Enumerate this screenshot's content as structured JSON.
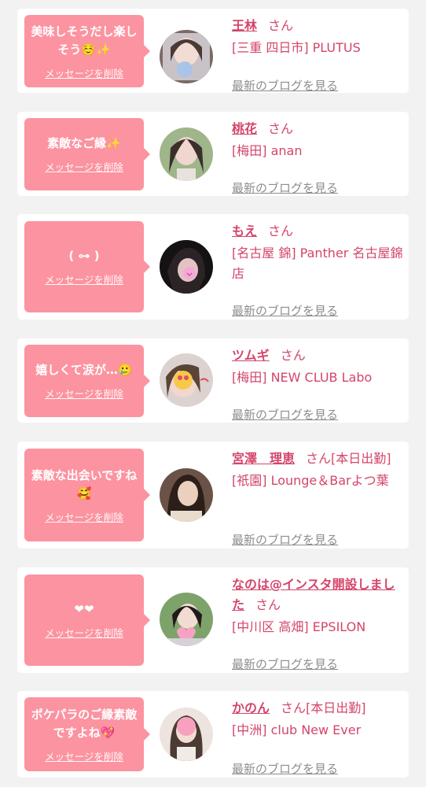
{
  "colors": {
    "background": "#f2f2f2",
    "card": "#ffffff",
    "bubble": "#fc93a0",
    "name_pink": "#d4456a",
    "link_gray": "#8d8d8d"
  },
  "delete_label": "メッセージを削除",
  "san_label": "さん",
  "blog_label": "最新のブログを見る",
  "entries": [
    {
      "message": "美味しそうだし楽しそう☺️✨",
      "name": "王林",
      "name_suffix": "",
      "shop": "[三重 四日市] PLUTUS"
    },
    {
      "message": "素敵なご縁✨",
      "name": "桃花",
      "name_suffix": "",
      "shop": "[梅田] anan"
    },
    {
      "message": "( ⊶ )",
      "name": "もえ",
      "name_suffix": "",
      "shop": "[名古屋 錦] Panther 名古屋錦店"
    },
    {
      "message": "嬉しくて涙が…🥲",
      "name": "ツムギ",
      "name_suffix": "",
      "shop": "[梅田] NEW CLUB Labo"
    },
    {
      "message": "素敵な出会いですね🥰",
      "name": "宮澤　理恵",
      "name_suffix": "[本日出勤]",
      "shop": "[祇園] Lounge＆Barよつ葉"
    },
    {
      "message": "❤❤",
      "name": "なのは@インスタ開設しました",
      "name_suffix": "",
      "shop": "[中川区 高畑] EPSILON"
    },
    {
      "message": "ポケパラのご縁素敵ですよね💖",
      "name": "かのん",
      "name_suffix": "[本日出勤]",
      "shop": "[中洲] club New Ever"
    }
  ]
}
